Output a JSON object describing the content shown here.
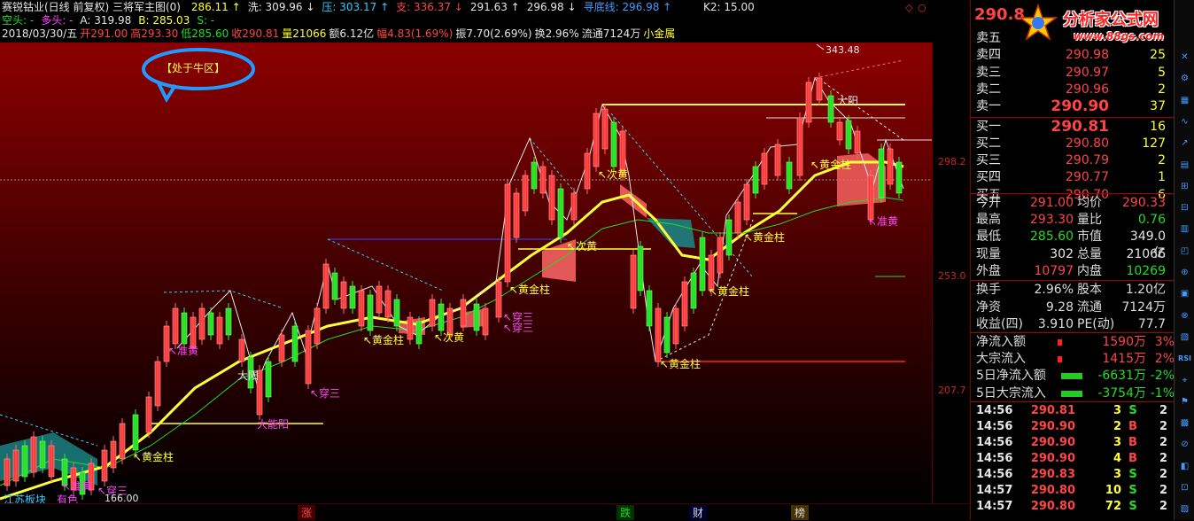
{
  "header": {
    "title": "赛锐钴业(日线 前复权) 三将军主图(0)",
    "top_values": [
      {
        "label": "286.11",
        "color": "#ffff33"
      },
      {
        "label": "洗: 309.96",
        "color": "#e6e6e6"
      },
      {
        "label": "压: 303.17",
        "color": "#33ccff"
      },
      {
        "label": "支: 336.37",
        "color": "#ff4444"
      },
      {
        "label": "291.63",
        "color": "#e6e6e6"
      },
      {
        "label": "296.98",
        "color": "#e6e6e6"
      },
      {
        "label": "寻底线: 296.98",
        "color": "#4499ff"
      }
    ],
    "k2": "K2: 15.00",
    "row2": [
      {
        "label": "空头: -",
        "color": "#22dd22"
      },
      {
        "label": "多头: -",
        "color": "#ff44ff"
      },
      {
        "label": "A: 319.98",
        "color": "#e6e6e6"
      },
      {
        "label": "B: 285.03",
        "color": "#ffff33"
      },
      {
        "label": "S: -",
        "color": "#22dd22"
      }
    ],
    "row3": [
      {
        "label": "2018/03/30/五",
        "color": "#e6e6e6"
      },
      {
        "label": "开291.00",
        "color": "#ff4444"
      },
      {
        "label": "高293.30",
        "color": "#ff4444"
      },
      {
        "label": "低285.60",
        "color": "#22dd22"
      },
      {
        "label": "收290.81",
        "color": "#ff4444"
      },
      {
        "label": "量21066",
        "color": "#ffff33"
      },
      {
        "label": "额6.12亿",
        "color": "#e6e6e6"
      },
      {
        "label": "幅4.83(1.69%)",
        "color": "#ff4444"
      },
      {
        "label": "振7.70(2.69%)",
        "color": "#e6e6e6"
      },
      {
        "label": "换2.96%",
        "color": "#e6e6e6"
      },
      {
        "label": "流通7124万",
        "color": "#e6e6e6"
      },
      {
        "label": "小金属",
        "color": "#ffff33"
      }
    ]
  },
  "chart": {
    "bubble_text": "【处于牛区】",
    "peak_label": "343.48",
    "low_label": "166.00",
    "axis_labels": [
      "298.2",
      "253.0",
      "207.7"
    ],
    "annotations": [
      {
        "text": "黄金柱",
        "color": "#ffff33"
      },
      {
        "text": "黄金柱",
        "color": "#ffff33"
      },
      {
        "text": "黄金柱",
        "color": "#ffff33"
      },
      {
        "text": "黄金柱",
        "color": "#ffff33"
      },
      {
        "text": "黄金柱",
        "color": "#ffff33"
      },
      {
        "text": "黄金柱",
        "color": "#ffff33"
      },
      {
        "text": "黄金柱",
        "color": "#ffff33"
      },
      {
        "text": "次黄",
        "color": "#ffff33"
      },
      {
        "text": "次黄",
        "color": "#ffff33"
      },
      {
        "text": "次黄",
        "color": "#ffff33"
      },
      {
        "text": "准黄",
        "color": "#ff44ff"
      },
      {
        "text": "准黄",
        "color": "#ff44ff"
      },
      {
        "text": "准黄",
        "color": "#ff44ff"
      },
      {
        "text": "穿三",
        "color": "#ff44ff"
      },
      {
        "text": "穿三",
        "color": "#ff44ff"
      },
      {
        "text": "穿三",
        "color": "#ff44ff"
      },
      {
        "text": "穿三",
        "color": "#ff44ff"
      },
      {
        "text": "大阳",
        "color": "#e6e6e6"
      },
      {
        "text": "大阳",
        "color": "#e6e6e6"
      },
      {
        "text": "大能阳",
        "color": "#ff44ff"
      },
      {
        "text": "有色",
        "color": "#ff44ff"
      },
      {
        "text": "江苏板块",
        "color": "#33ccff"
      }
    ]
  },
  "bottom_tabs": [
    {
      "label": "涨",
      "color": "#ff4444"
    },
    {
      "label": "跌",
      "color": "#22dd22"
    },
    {
      "label": "财",
      "color": "#e6e6e6"
    },
    {
      "label": "榜",
      "color": "#e6e6e6"
    }
  ],
  "panel": {
    "price_header": "290.8",
    "logo_text": "分析家公式网",
    "logo_url": "www.88gs.com",
    "sell": [
      {
        "label": "卖五",
        "price": "",
        "vol": ""
      },
      {
        "label": "卖四",
        "price": "290.98",
        "vol": "25"
      },
      {
        "label": "卖三",
        "price": "290.97",
        "vol": "5"
      },
      {
        "label": "卖二",
        "price": "290.96",
        "vol": "2"
      },
      {
        "label": "卖一",
        "price": "290.90",
        "vol": "37"
      }
    ],
    "buy": [
      {
        "label": "买一",
        "price": "290.81",
        "vol": "16"
      },
      {
        "label": "买二",
        "price": "290.80",
        "vol": "127"
      },
      {
        "label": "买三",
        "price": "290.79",
        "vol": "2"
      },
      {
        "label": "买四",
        "price": "290.77",
        "vol": "1"
      },
      {
        "label": "买五",
        "price": "290.70",
        "vol": "6"
      }
    ],
    "quote": [
      {
        "l1": "今开",
        "v1": "291.00",
        "c1": "#ff4444",
        "l2": "均价",
        "v2": "290.33",
        "c2": "#ff4444"
      },
      {
        "l1": "最高",
        "v1": "293.30",
        "c1": "#ff4444",
        "l2": "量比",
        "v2": "0.76",
        "c2": "#22dd22"
      },
      {
        "l1": "最低",
        "v1": "285.60",
        "c1": "#22dd22",
        "l2": "市值",
        "v2": "349.0亿",
        "c2": "#e6e6e6"
      },
      {
        "l1": "现量",
        "v1": "302",
        "c1": "#e6e6e6",
        "l2": "总量",
        "v2": "21066",
        "c2": "#e6e6e6"
      },
      {
        "l1": "外盘",
        "v1": "10797",
        "c1": "#ff4444",
        "l2": "内盘",
        "v2": "10269",
        "c2": "#22dd22"
      }
    ],
    "fundamentals": [
      {
        "l1": "换手",
        "v1": "2.96%",
        "l2": "股本",
        "v2": "1.20亿"
      },
      {
        "l1": "净资",
        "v1": "9.28",
        "l2": "流通",
        "v2": "7124万"
      },
      {
        "l1": "收益(四)",
        "v1": "3.910",
        "l2": "PE(动)",
        "v2": "77.7"
      }
    ],
    "flows": [
      {
        "label": "净流入额",
        "value": "1590万",
        "pct": "3%",
        "color": "#ff4444",
        "bar": "red"
      },
      {
        "label": "大宗流入",
        "value": "1415万",
        "pct": "2%",
        "color": "#ff4444",
        "bar": "red"
      },
      {
        "label": "5日净流入额",
        "value": "-6631万",
        "pct": "-2%",
        "color": "#22dd22",
        "bar": "green"
      },
      {
        "label": "5日大宗流入",
        "value": "-3754万",
        "pct": "-1%",
        "color": "#22dd22",
        "bar": "green"
      }
    ],
    "ticks": [
      {
        "time": "14:56",
        "price": "290.81",
        "vol": "3",
        "side": "S",
        "n": "2"
      },
      {
        "time": "14:56",
        "price": "290.90",
        "vol": "2",
        "side": "B",
        "n": "2"
      },
      {
        "time": "14:56",
        "price": "290.90",
        "vol": "3",
        "side": "B",
        "n": "2"
      },
      {
        "time": "14:56",
        "price": "290.90",
        "vol": "4",
        "side": "B",
        "n": "2"
      },
      {
        "time": "14:56",
        "price": "290.83",
        "vol": "3",
        "side": "S",
        "n": "2"
      },
      {
        "time": "14:57",
        "price": "290.80",
        "vol": "10",
        "side": "S",
        "n": "2"
      },
      {
        "time": "14:57",
        "price": "290.80",
        "vol": "72",
        "side": "S",
        "n": "2"
      }
    ]
  },
  "toolbar": {
    "buttons": [
      "✕",
      "⚙",
      "▦",
      "∿",
      "↗",
      "▤",
      "⊞",
      "⊟",
      "▥",
      "◰",
      "⊕",
      "▣",
      "⊗",
      "▧",
      "RSI",
      "⌖",
      "⚑",
      "▩",
      "⊘",
      "◧",
      "⊡",
      "▨"
    ]
  },
  "colors": {
    "up": "#ff3333",
    "down": "#22dd22",
    "ma": "#ffff33",
    "bg_top": "#8b0000"
  }
}
